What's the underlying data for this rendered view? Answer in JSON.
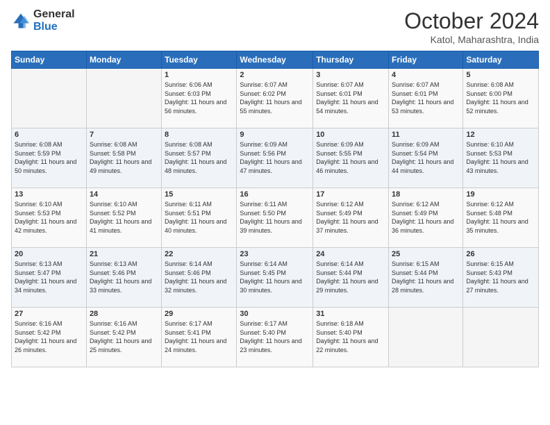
{
  "logo": {
    "general": "General",
    "blue": "Blue"
  },
  "title": "October 2024",
  "location": "Katol, Maharashtra, India",
  "weekdays": [
    "Sunday",
    "Monday",
    "Tuesday",
    "Wednesday",
    "Thursday",
    "Friday",
    "Saturday"
  ],
  "weeks": [
    [
      {
        "day": "",
        "empty": true
      },
      {
        "day": "",
        "empty": true
      },
      {
        "day": "1",
        "sunrise": "Sunrise: 6:06 AM",
        "sunset": "Sunset: 6:03 PM",
        "daylight": "Daylight: 11 hours and 56 minutes."
      },
      {
        "day": "2",
        "sunrise": "Sunrise: 6:07 AM",
        "sunset": "Sunset: 6:02 PM",
        "daylight": "Daylight: 11 hours and 55 minutes."
      },
      {
        "day": "3",
        "sunrise": "Sunrise: 6:07 AM",
        "sunset": "Sunset: 6:01 PM",
        "daylight": "Daylight: 11 hours and 54 minutes."
      },
      {
        "day": "4",
        "sunrise": "Sunrise: 6:07 AM",
        "sunset": "Sunset: 6:01 PM",
        "daylight": "Daylight: 11 hours and 53 minutes."
      },
      {
        "day": "5",
        "sunrise": "Sunrise: 6:08 AM",
        "sunset": "Sunset: 6:00 PM",
        "daylight": "Daylight: 11 hours and 52 minutes."
      }
    ],
    [
      {
        "day": "6",
        "sunrise": "Sunrise: 6:08 AM",
        "sunset": "Sunset: 5:59 PM",
        "daylight": "Daylight: 11 hours and 50 minutes."
      },
      {
        "day": "7",
        "sunrise": "Sunrise: 6:08 AM",
        "sunset": "Sunset: 5:58 PM",
        "daylight": "Daylight: 11 hours and 49 minutes."
      },
      {
        "day": "8",
        "sunrise": "Sunrise: 6:08 AM",
        "sunset": "Sunset: 5:57 PM",
        "daylight": "Daylight: 11 hours and 48 minutes."
      },
      {
        "day": "9",
        "sunrise": "Sunrise: 6:09 AM",
        "sunset": "Sunset: 5:56 PM",
        "daylight": "Daylight: 11 hours and 47 minutes."
      },
      {
        "day": "10",
        "sunrise": "Sunrise: 6:09 AM",
        "sunset": "Sunset: 5:55 PM",
        "daylight": "Daylight: 11 hours and 46 minutes."
      },
      {
        "day": "11",
        "sunrise": "Sunrise: 6:09 AM",
        "sunset": "Sunset: 5:54 PM",
        "daylight": "Daylight: 11 hours and 44 minutes."
      },
      {
        "day": "12",
        "sunrise": "Sunrise: 6:10 AM",
        "sunset": "Sunset: 5:53 PM",
        "daylight": "Daylight: 11 hours and 43 minutes."
      }
    ],
    [
      {
        "day": "13",
        "sunrise": "Sunrise: 6:10 AM",
        "sunset": "Sunset: 5:53 PM",
        "daylight": "Daylight: 11 hours and 42 minutes."
      },
      {
        "day": "14",
        "sunrise": "Sunrise: 6:10 AM",
        "sunset": "Sunset: 5:52 PM",
        "daylight": "Daylight: 11 hours and 41 minutes."
      },
      {
        "day": "15",
        "sunrise": "Sunrise: 6:11 AM",
        "sunset": "Sunset: 5:51 PM",
        "daylight": "Daylight: 11 hours and 40 minutes."
      },
      {
        "day": "16",
        "sunrise": "Sunrise: 6:11 AM",
        "sunset": "Sunset: 5:50 PM",
        "daylight": "Daylight: 11 hours and 39 minutes."
      },
      {
        "day": "17",
        "sunrise": "Sunrise: 6:12 AM",
        "sunset": "Sunset: 5:49 PM",
        "daylight": "Daylight: 11 hours and 37 minutes."
      },
      {
        "day": "18",
        "sunrise": "Sunrise: 6:12 AM",
        "sunset": "Sunset: 5:49 PM",
        "daylight": "Daylight: 11 hours and 36 minutes."
      },
      {
        "day": "19",
        "sunrise": "Sunrise: 6:12 AM",
        "sunset": "Sunset: 5:48 PM",
        "daylight": "Daylight: 11 hours and 35 minutes."
      }
    ],
    [
      {
        "day": "20",
        "sunrise": "Sunrise: 6:13 AM",
        "sunset": "Sunset: 5:47 PM",
        "daylight": "Daylight: 11 hours and 34 minutes."
      },
      {
        "day": "21",
        "sunrise": "Sunrise: 6:13 AM",
        "sunset": "Sunset: 5:46 PM",
        "daylight": "Daylight: 11 hours and 33 minutes."
      },
      {
        "day": "22",
        "sunrise": "Sunrise: 6:14 AM",
        "sunset": "Sunset: 5:46 PM",
        "daylight": "Daylight: 11 hours and 32 minutes."
      },
      {
        "day": "23",
        "sunrise": "Sunrise: 6:14 AM",
        "sunset": "Sunset: 5:45 PM",
        "daylight": "Daylight: 11 hours and 30 minutes."
      },
      {
        "day": "24",
        "sunrise": "Sunrise: 6:14 AM",
        "sunset": "Sunset: 5:44 PM",
        "daylight": "Daylight: 11 hours and 29 minutes."
      },
      {
        "day": "25",
        "sunrise": "Sunrise: 6:15 AM",
        "sunset": "Sunset: 5:44 PM",
        "daylight": "Daylight: 11 hours and 28 minutes."
      },
      {
        "day": "26",
        "sunrise": "Sunrise: 6:15 AM",
        "sunset": "Sunset: 5:43 PM",
        "daylight": "Daylight: 11 hours and 27 minutes."
      }
    ],
    [
      {
        "day": "27",
        "sunrise": "Sunrise: 6:16 AM",
        "sunset": "Sunset: 5:42 PM",
        "daylight": "Daylight: 11 hours and 26 minutes."
      },
      {
        "day": "28",
        "sunrise": "Sunrise: 6:16 AM",
        "sunset": "Sunset: 5:42 PM",
        "daylight": "Daylight: 11 hours and 25 minutes."
      },
      {
        "day": "29",
        "sunrise": "Sunrise: 6:17 AM",
        "sunset": "Sunset: 5:41 PM",
        "daylight": "Daylight: 11 hours and 24 minutes."
      },
      {
        "day": "30",
        "sunrise": "Sunrise: 6:17 AM",
        "sunset": "Sunset: 5:40 PM",
        "daylight": "Daylight: 11 hours and 23 minutes."
      },
      {
        "day": "31",
        "sunrise": "Sunrise: 6:18 AM",
        "sunset": "Sunset: 5:40 PM",
        "daylight": "Daylight: 11 hours and 22 minutes."
      },
      {
        "day": "",
        "empty": true
      },
      {
        "day": "",
        "empty": true
      }
    ]
  ]
}
